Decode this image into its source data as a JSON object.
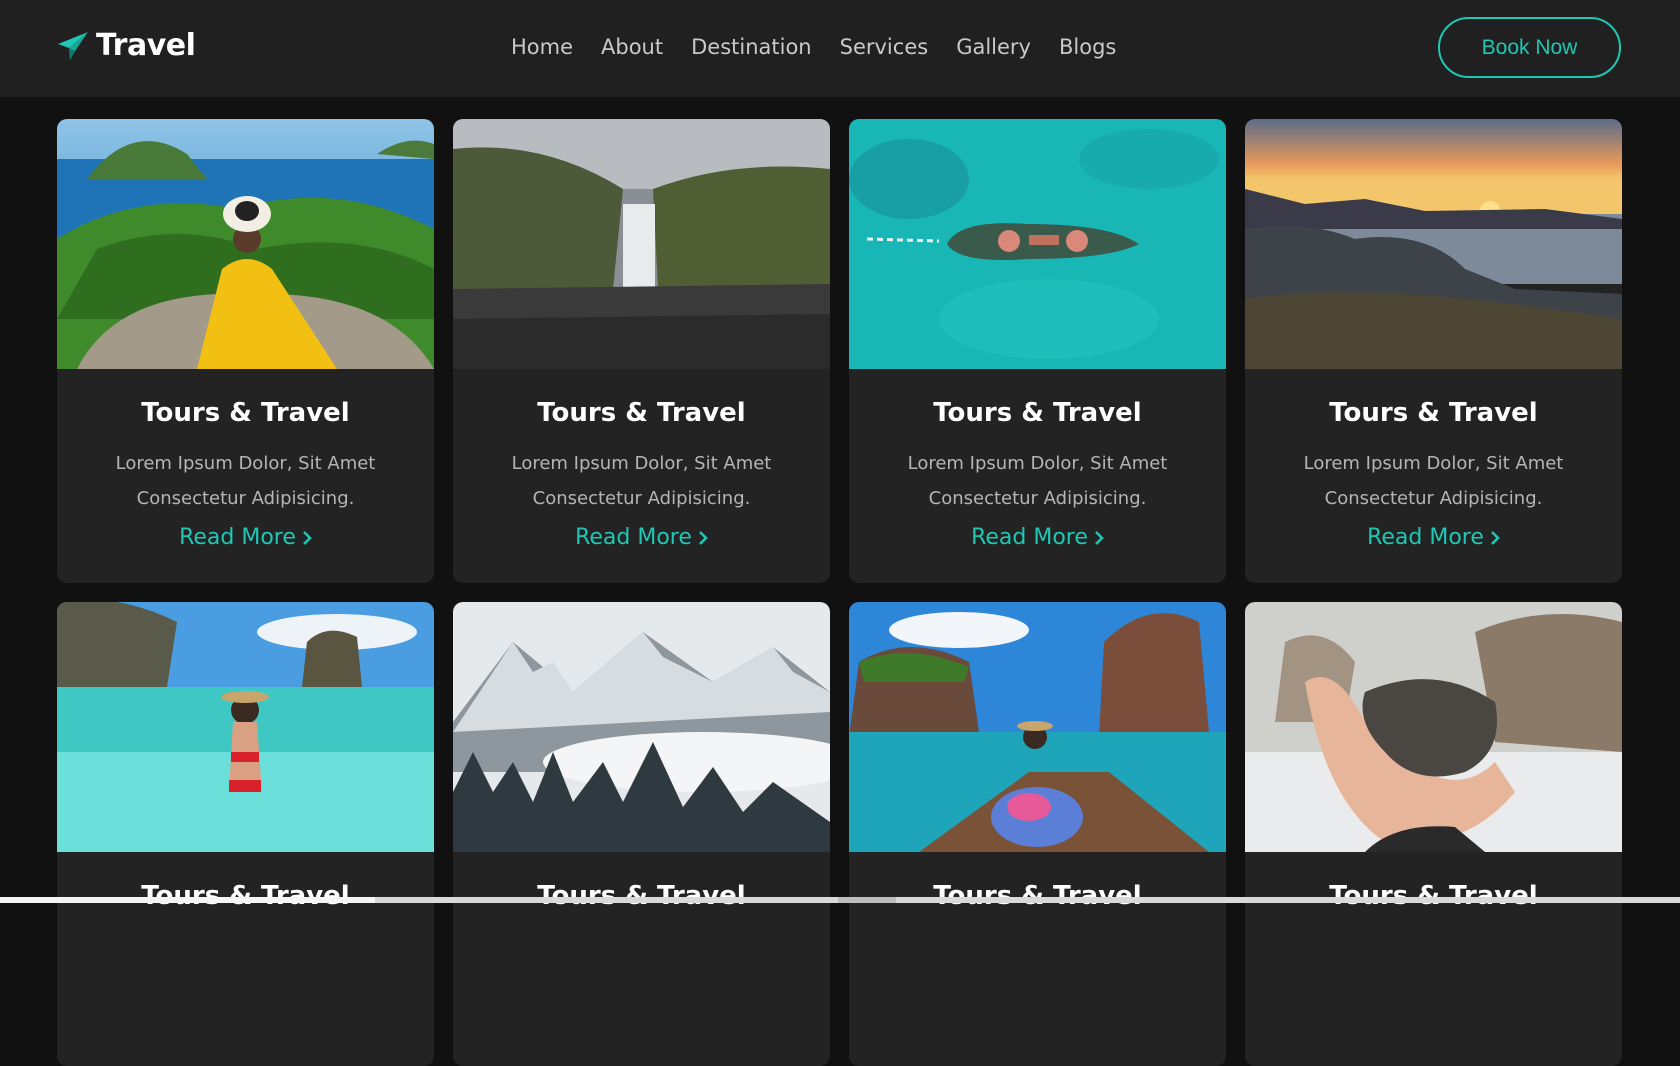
{
  "brand": {
    "name": "Travel",
    "icon": "paper-plane-icon",
    "accent": "#1ec8b4"
  },
  "nav": {
    "items": [
      "Home",
      "About",
      "Destination",
      "Services",
      "Gallery",
      "Blogs"
    ],
    "cta": "Book Now"
  },
  "cards": [
    {
      "title": "Tours & Travel",
      "desc1": "Lorem Ipsum Dolor, Sit Amet",
      "desc2": "Consectetur Adipisicing.",
      "link": "Read More",
      "image": "woman-yellow-dress-island-view"
    },
    {
      "title": "Tours & Travel",
      "desc1": "Lorem Ipsum Dolor, Sit Amet",
      "desc2": "Consectetur Adipisicing.",
      "link": "Read More",
      "image": "waterfall-cliffs"
    },
    {
      "title": "Tours & Travel",
      "desc1": "Lorem Ipsum Dolor, Sit Amet",
      "desc2": "Consectetur Adipisicing.",
      "link": "Read More",
      "image": "shipwreck-turquoise-sea"
    },
    {
      "title": "Tours & Travel",
      "desc1": "Lorem Ipsum Dolor, Sit Amet",
      "desc2": "Consectetur Adipisicing.",
      "link": "Read More",
      "image": "sunset-rocky-coast"
    },
    {
      "title": "Tours & Travel",
      "desc1": "",
      "desc2": "",
      "link": "",
      "image": "woman-tropical-lagoon"
    },
    {
      "title": "Tours & Travel",
      "desc1": "",
      "desc2": "",
      "link": "",
      "image": "snowy-mountains-forest"
    },
    {
      "title": "Tours & Travel",
      "desc1": "",
      "desc2": "",
      "link": "",
      "image": "woman-on-boat-cliffs"
    },
    {
      "title": "Tours & Travel",
      "desc1": "",
      "desc2": "",
      "link": "",
      "image": "hand-holding-stone"
    }
  ]
}
